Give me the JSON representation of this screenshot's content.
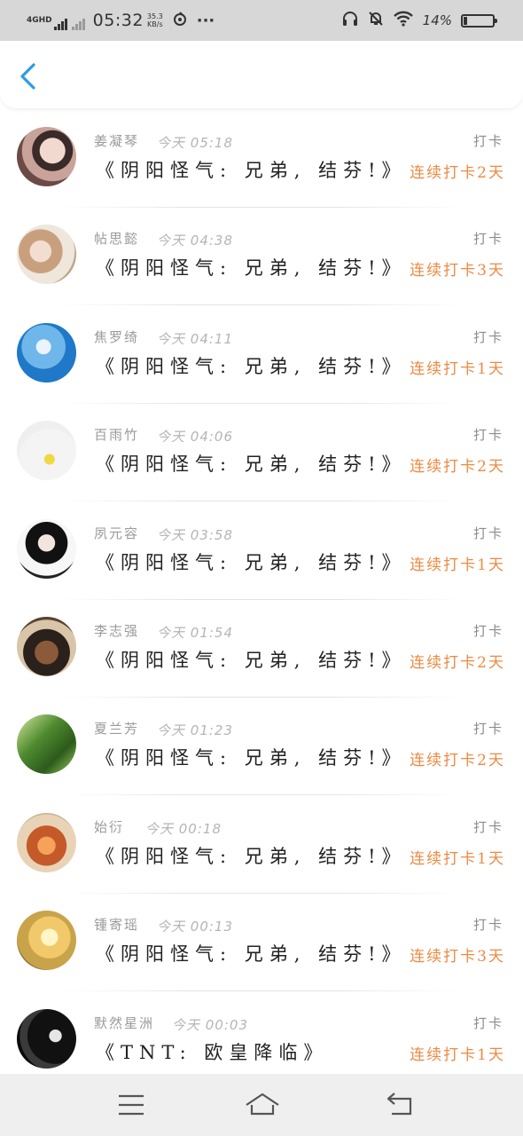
{
  "status_bar": {
    "network": "4GHD",
    "time": "05:32",
    "speed_value": "35.3",
    "speed_unit": "KB/s",
    "battery_percent": "14%",
    "battery_level": 0.14,
    "icons": [
      "signal-icon",
      "sync-icon",
      "more-icon",
      "headphones-icon",
      "mute-bell-icon",
      "wifi-icon",
      "battery-icon"
    ]
  },
  "header": {
    "back_icon": "chevron-left-icon",
    "accent": "#2f9be6"
  },
  "colors": {
    "streak": "#ec8a43",
    "name": "#9a9a9a",
    "time": "#b5b5b5"
  },
  "entries": [
    {
      "name": "姜凝琴",
      "time": "今天 05:18",
      "title": "《阴阳怪气:  兄弟,  结芬!》",
      "checkin": "打卡",
      "streak": "连续打卡2天"
    },
    {
      "name": "帖思懿",
      "time": "今天 04:38",
      "title": "《阴阳怪气:  兄弟,  结芬!》",
      "checkin": "打卡",
      "streak": "连续打卡3天"
    },
    {
      "name": "焦罗绮",
      "time": "今天 04:11",
      "title": "《阴阳怪气:  兄弟,  结芬!》",
      "checkin": "打卡",
      "streak": "连续打卡1天"
    },
    {
      "name": "百雨竹",
      "time": "今天 04:06",
      "title": "《阴阳怪气:  兄弟,  结芬!》",
      "checkin": "打卡",
      "streak": "连续打卡2天"
    },
    {
      "name": "夙元容",
      "time": "今天 03:58",
      "title": "《阴阳怪气:  兄弟,  结芬!》",
      "checkin": "打卡",
      "streak": "连续打卡1天"
    },
    {
      "name": "李志强",
      "time": "今天 01:54",
      "title": "《阴阳怪气:  兄弟,  结芬!》",
      "checkin": "打卡",
      "streak": "连续打卡2天"
    },
    {
      "name": "夏兰芳",
      "time": "今天 01:23",
      "title": "《阴阳怪气:  兄弟,  结芬!》",
      "checkin": "打卡",
      "streak": "连续打卡2天"
    },
    {
      "name": "始衍",
      "time": "今天 00:18",
      "title": "《阴阳怪气:  兄弟,  结芬!》",
      "checkin": "打卡",
      "streak": "连续打卡1天"
    },
    {
      "name": "锺寄瑶",
      "time": "今天 00:13",
      "title": "《阴阳怪气:  兄弟,  结芬!》",
      "checkin": "打卡",
      "streak": "连续打卡3天"
    },
    {
      "name": "默然星洲",
      "time": "今天 00:03",
      "title": "《TNT:  欧皇降临》",
      "checkin": "打卡",
      "streak": "连续打卡1天"
    }
  ],
  "nav_bar": {
    "icons": [
      "menu-icon",
      "home-icon",
      "back-icon"
    ]
  }
}
